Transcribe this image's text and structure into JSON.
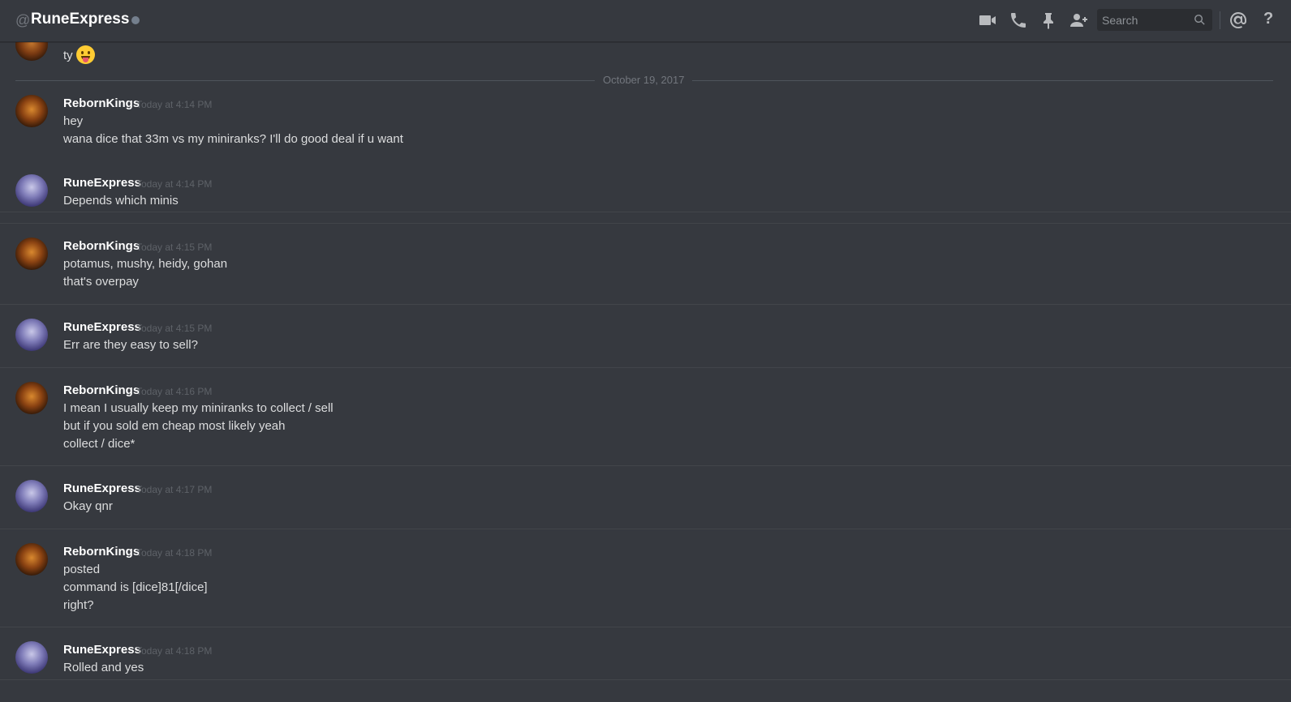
{
  "header": {
    "at_symbol": "@",
    "channel_name": "RuneExpress",
    "search_placeholder": "Search",
    "help_label": "?"
  },
  "partial_message": {
    "text": "ty",
    "emoji": "stuck-out-tongue-emoji"
  },
  "date_divider": "October 19, 2017",
  "messages": [
    {
      "author": "RebornKings",
      "timestamp": "Today at 4:14 PM",
      "lines": [
        "hey",
        "wana dice that 33m vs my miniranks? I'll do good deal if u want"
      ]
    },
    {
      "author": "RuneExpress",
      "timestamp": "Today at 4:14 PM",
      "lines": [
        "Depends which minis"
      ]
    },
    {
      "author": "RebornKings",
      "timestamp": "Today at 4:15 PM",
      "lines": [
        "potamus, mushy, heidy, gohan",
        "that's overpay"
      ]
    },
    {
      "author": "RuneExpress",
      "timestamp": "Today at 4:15 PM",
      "lines": [
        "Err are they easy to sell?"
      ]
    },
    {
      "author": "RebornKings",
      "timestamp": "Today at 4:16 PM",
      "lines": [
        "I mean I usually keep my miniranks to collect / sell",
        "but if you sold em cheap most likely yeah",
        "collect / dice*"
      ]
    },
    {
      "author": "RuneExpress",
      "timestamp": "Today at 4:17 PM",
      "lines": [
        "Okay qnr"
      ]
    },
    {
      "author": "RebornKings",
      "timestamp": "Today at 4:18 PM",
      "lines": [
        "posted",
        "command is [dice]81[/dice]",
        "right?"
      ]
    },
    {
      "author": "RuneExpress",
      "timestamp": "Today at 4:18 PM",
      "lines": [
        "Rolled and yes"
      ]
    }
  ],
  "colors": {
    "background": "#36393f",
    "text": "#dcddde",
    "username": "#ffffff",
    "timestamp": "#5e6268",
    "divider": "#42454a"
  },
  "icons": [
    "video-call-icon",
    "voice-call-icon",
    "pin-icon",
    "add-friend-icon",
    "search-icon",
    "mention-icon",
    "help-icon"
  ]
}
